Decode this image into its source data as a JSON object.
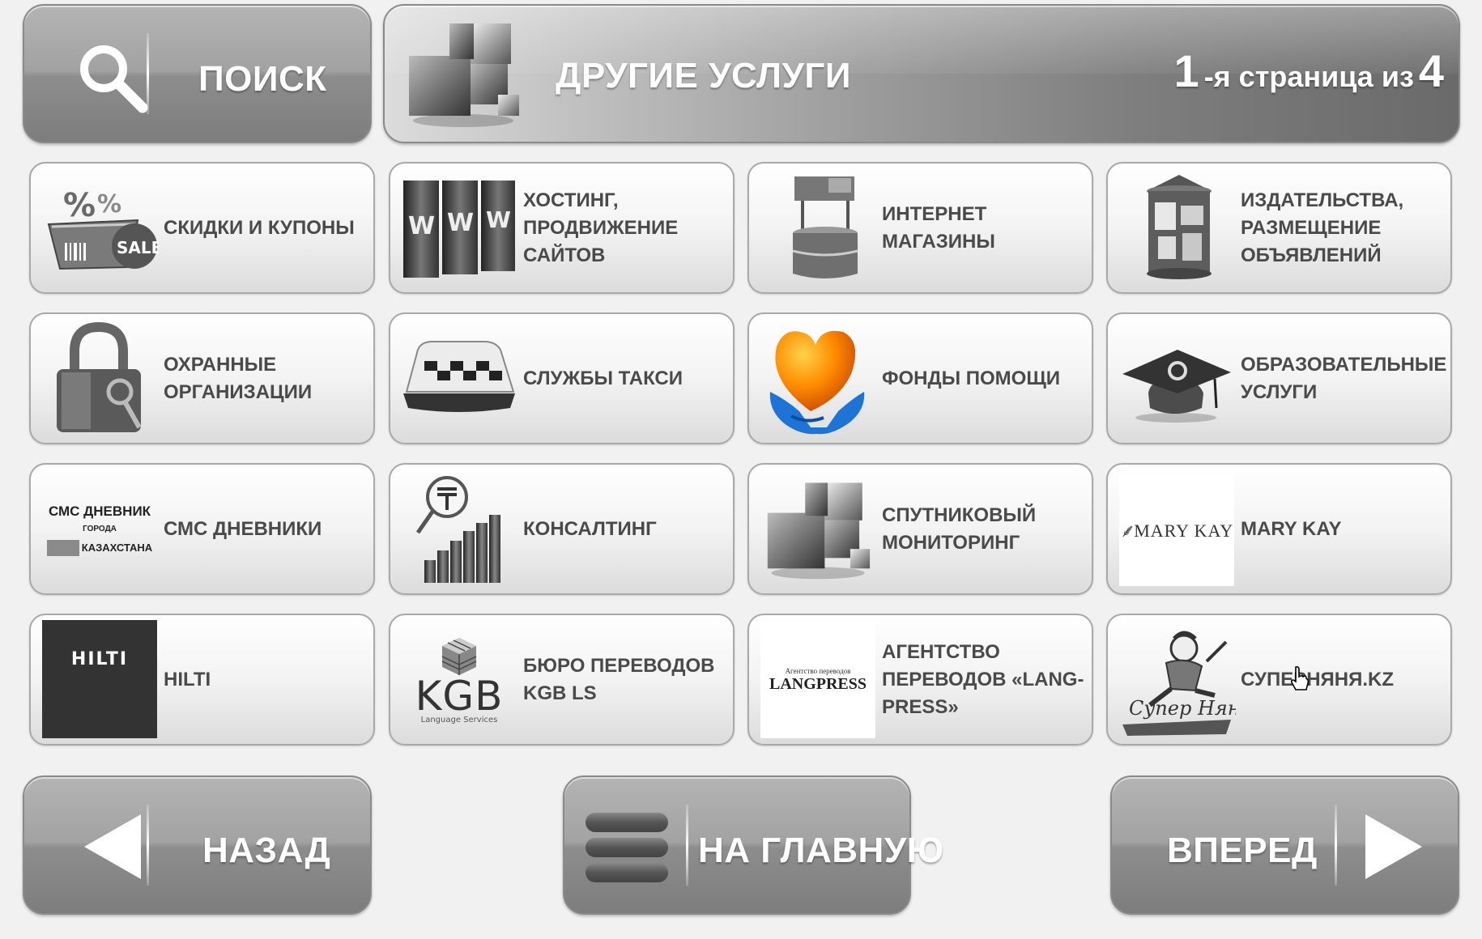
{
  "search": {
    "label": "ПОИСК"
  },
  "header": {
    "title": "ДРУГИЕ УСЛУГИ",
    "page": {
      "current": "1",
      "mid": "-я страница из",
      "total": "4"
    }
  },
  "tiles": [
    {
      "label": "СКИДКИ И КУПОНЫ",
      "icon": "sale-basket-icon"
    },
    {
      "label": "ХОСТИНГ,\nПРОДВИЖЕНИЕ\nСАЙТОВ",
      "icon": "www-servers-icon"
    },
    {
      "label": "ИНТЕРНЕТ\nМАГАЗИНЫ",
      "icon": "kiosk-stand-icon"
    },
    {
      "label": "ИЗДАТЕЛЬСТВА,\nРАЗМЕЩЕНИЕ\nОБЪЯВЛЕНИЙ",
      "icon": "advertising-column-icon"
    },
    {
      "label": "ОХРАННЫЕ\nОРГАНИЗАЦИИ",
      "icon": "padlock-icon"
    },
    {
      "label": "СЛУЖБЫ ТАКСИ",
      "icon": "taxi-sign-icon"
    },
    {
      "label": "ФОНДЫ ПОМОЩИ",
      "icon": "heart-in-hands-icon"
    },
    {
      "label": "ОБРАЗОВАТЕЛЬНЫЕ\nУСЛУГИ",
      "icon": "graduation-cap-icon"
    },
    {
      "label": "СМС ДНЕВНИКИ",
      "icon": "sms-diary-logo",
      "logo": [
        "СМС ДНЕВНИК",
        "ГОРОДА",
        "КАЗАХСТАНА"
      ]
    },
    {
      "label": "КОНСАЛТИНГ",
      "icon": "tenge-growth-chart-icon"
    },
    {
      "label": "СПУТНИКОВЫЙ\nМОНИТОРИНГ",
      "icon": "cubes-icon"
    },
    {
      "label": "MARY KAY",
      "icon": "mary-kay-logo",
      "logo": [
        "MARY KAY"
      ]
    },
    {
      "label": "HILTI",
      "icon": "hilti-logo",
      "logo": [
        "HILTI"
      ]
    },
    {
      "label": "БЮРО ПЕРЕВОДОВ\nKGB LS",
      "icon": "kgb-logo",
      "logo": [
        "KGB",
        "Language Services"
      ]
    },
    {
      "label": "АГЕНТСТВО\nПЕРЕВОДОВ «LANG-\nPRESS»",
      "icon": "langpress-logo",
      "logo": [
        "Агентство переводов",
        "LANGPRESS"
      ]
    },
    {
      "label": "СУПЕРНЯНЯ.KZ",
      "icon": "super-nanny-logo",
      "logo": [
        "Супер Няня"
      ]
    }
  ],
  "nav": {
    "back": "НАЗАД",
    "home": "НА ГЛАВНУЮ",
    "forward": "ВПЕРЕД"
  },
  "colors": {
    "tile_text": "#4a4a4a",
    "button_gray": "#9a9a9a",
    "background": "#f1f1f1"
  }
}
